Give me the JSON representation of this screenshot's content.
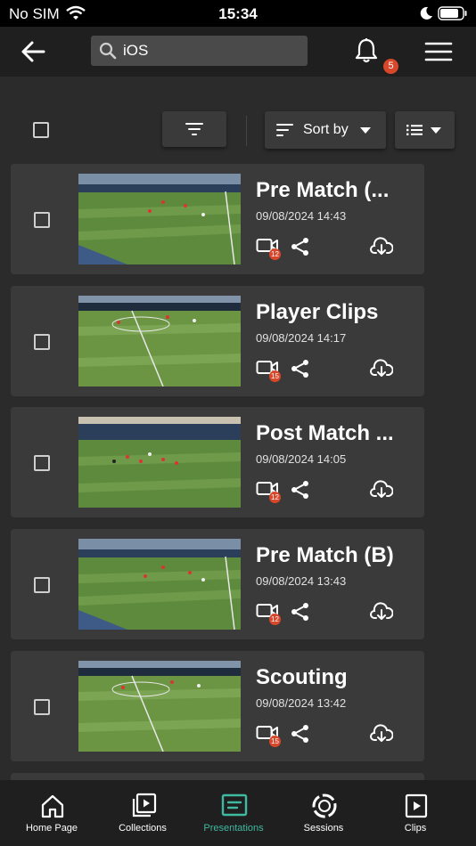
{
  "status_bar": {
    "carrier": "No SIM",
    "time": "15:34"
  },
  "header": {
    "search_value": "iOS",
    "notification_count": "5"
  },
  "toolbar": {
    "sort_label": "Sort by"
  },
  "presentations": [
    {
      "title": "Pre Match (...",
      "date": "09/08/2024 14:43",
      "clip_count": "12"
    },
    {
      "title": "Player Clips",
      "date": "09/08/2024 14:17",
      "clip_count": "15"
    },
    {
      "title": "Post Match ...",
      "date": "09/08/2024 14:05",
      "clip_count": "12"
    },
    {
      "title": "Pre Match (B)",
      "date": "09/08/2024 13:43",
      "clip_count": "12"
    },
    {
      "title": "Scouting",
      "date": "09/08/2024 13:42",
      "clip_count": "15"
    }
  ],
  "bottom_nav": [
    {
      "label": "Home Page",
      "icon": "home-icon"
    },
    {
      "label": "Collections",
      "icon": "collections-icon"
    },
    {
      "label": "Presentations",
      "icon": "presentations-icon",
      "active": true
    },
    {
      "label": "Sessions",
      "icon": "sessions-icon"
    },
    {
      "label": "Clips",
      "icon": "clips-icon"
    }
  ],
  "colors": {
    "accent": "#3fb9a0",
    "badge": "#d9472b",
    "card": "#3a3a3a",
    "background": "#2b2b2b"
  }
}
